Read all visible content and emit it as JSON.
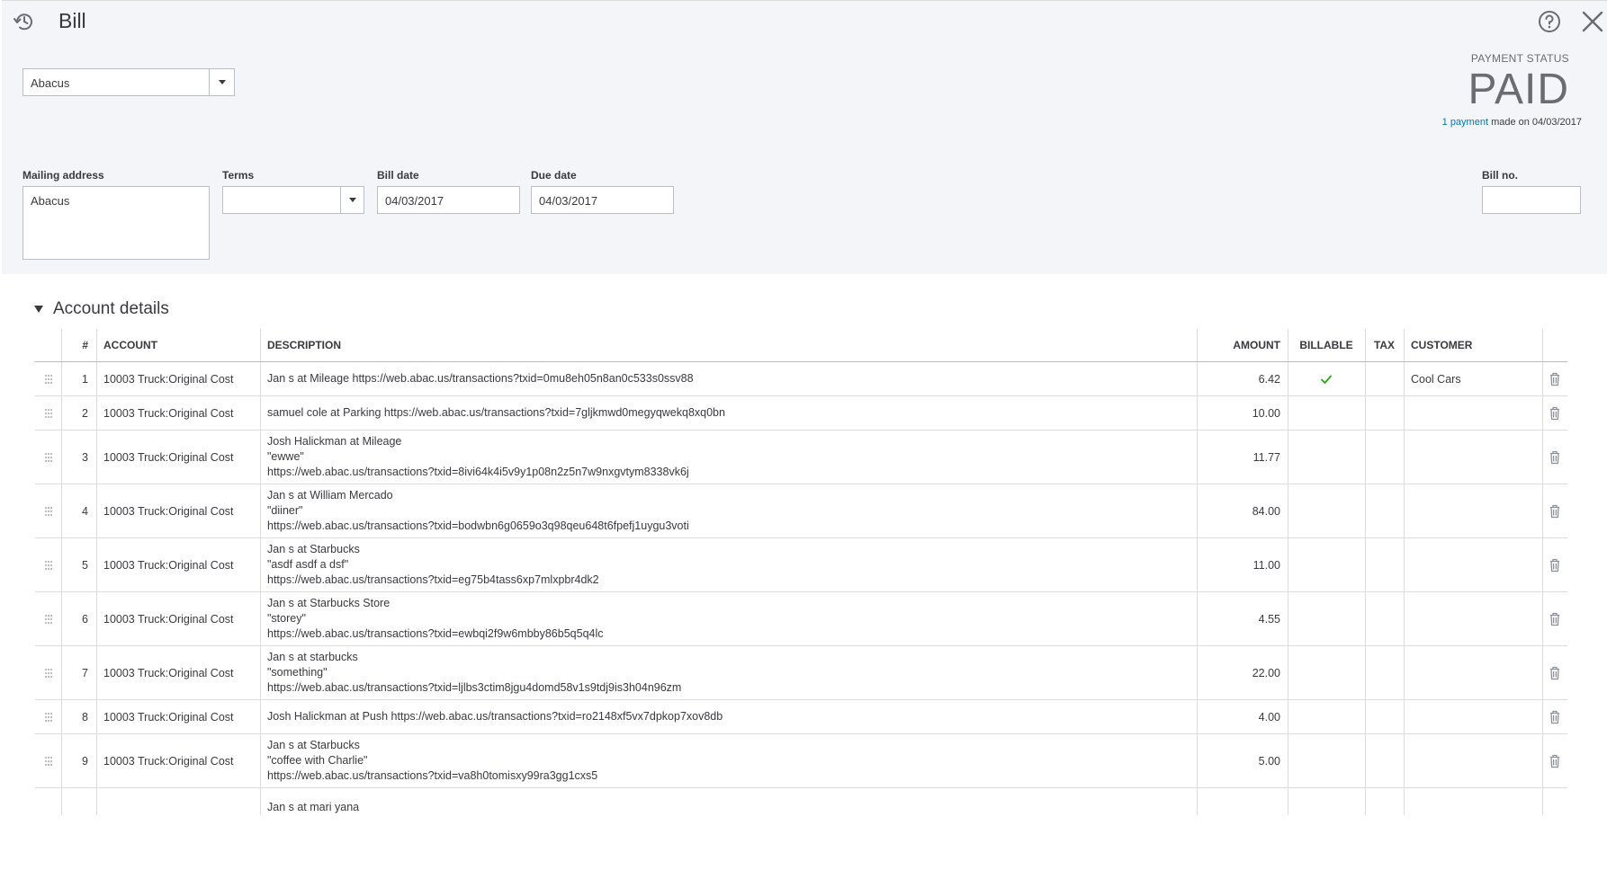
{
  "header": {
    "title": "Bill"
  },
  "vendor": {
    "selected": "Abacus"
  },
  "payment_status": {
    "label": "PAYMENT STATUS",
    "value": "PAID",
    "payment_link": "1 payment",
    "payment_suffix": " made on 04/03/2017"
  },
  "form": {
    "mailing_address_label": "Mailing address",
    "mailing_address_value": "Abacus",
    "terms_label": "Terms",
    "terms_value": "",
    "bill_date_label": "Bill date",
    "bill_date_value": "04/03/2017",
    "due_date_label": "Due date",
    "due_date_value": "04/03/2017",
    "bill_no_label": "Bill no.",
    "bill_no_value": ""
  },
  "account_details": {
    "title": "Account details",
    "columns": {
      "num": "#",
      "account": "ACCOUNT",
      "description": "DESCRIPTION",
      "amount": "AMOUNT",
      "billable": "BILLABLE",
      "tax": "TAX",
      "customer": "CUSTOMER"
    },
    "rows": [
      {
        "num": "1",
        "account": "10003 Truck:Original Cost",
        "description": [
          "Jan s at Mileage https://web.abac.us/transactions?txid=0mu8eh05n8an0c533s0ssv88"
        ],
        "amount": "6.42",
        "billable": true,
        "customer": "Cool Cars"
      },
      {
        "num": "2",
        "account": "10003 Truck:Original Cost",
        "description": [
          "samuel cole at Parking https://web.abac.us/transactions?txid=7gljkmwd0megyqwekq8xq0bn"
        ],
        "amount": "10.00",
        "billable": false,
        "customer": ""
      },
      {
        "num": "3",
        "account": "10003 Truck:Original Cost",
        "description": [
          "Josh Halickman at Mileage",
          "\"ewwe\"",
          "https://web.abac.us/transactions?txid=8ivi64k4i5v9y1p08n2z5n7w9nxgvtym8338vk6j"
        ],
        "amount": "11.77",
        "billable": false,
        "customer": ""
      },
      {
        "num": "4",
        "account": "10003 Truck:Original Cost",
        "description": [
          "Jan s at William Mercado",
          "\"diiner\"",
          "https://web.abac.us/transactions?txid=bodwbn6g0659o3q98qeu648t6fpefj1uygu3voti"
        ],
        "amount": "84.00",
        "billable": false,
        "customer": ""
      },
      {
        "num": "5",
        "account": "10003 Truck:Original Cost",
        "description": [
          "Jan s at Starbucks",
          "\"asdf asdf a dsf\"",
          "https://web.abac.us/transactions?txid=eg75b4tass6xp7mlxpbr4dk2"
        ],
        "amount": "11.00",
        "billable": false,
        "customer": ""
      },
      {
        "num": "6",
        "account": "10003 Truck:Original Cost",
        "description": [
          "Jan s at Starbucks Store",
          "\"storey\"",
          "https://web.abac.us/transactions?txid=ewbqi2f9w6mbby86b5q5q4lc"
        ],
        "amount": "4.55",
        "billable": false,
        "customer": ""
      },
      {
        "num": "7",
        "account": "10003 Truck:Original Cost",
        "description": [
          "Jan s at starbucks",
          "\"something\"",
          "https://web.abac.us/transactions?txid=ljlbs3ctim8jgu4domd58v1s9tdj9is3h04n96zm"
        ],
        "amount": "22.00",
        "billable": false,
        "customer": ""
      },
      {
        "num": "8",
        "account": "10003 Truck:Original Cost",
        "description": [
          "Josh Halickman at Push https://web.abac.us/transactions?txid=ro2148xf5vx7dpkop7xov8db"
        ],
        "amount": "4.00",
        "billable": false,
        "customer": ""
      },
      {
        "num": "9",
        "account": "10003 Truck:Original Cost",
        "description": [
          "Jan s at Starbucks",
          "\"coffee with Charlie\"",
          "https://web.abac.us/transactions?txid=va8h0tomisxy99ra3gg1cxs5"
        ],
        "amount": "5.00",
        "billable": false,
        "customer": ""
      },
      {
        "num": "",
        "account": "",
        "description": [
          "Jan s at mari yana"
        ],
        "amount": "",
        "billable": false,
        "customer": ""
      }
    ]
  },
  "icons": {
    "history": "history-icon",
    "help": "help-icon",
    "close": "close-icon",
    "drag": "drag-handle-icon",
    "delete": "trash-icon",
    "billable_check": "checkmark-icon"
  },
  "colors": {
    "link": "#0077c5",
    "check": "#2ca01c",
    "header_band": "#f4f5f8",
    "text": "#393a3d"
  }
}
